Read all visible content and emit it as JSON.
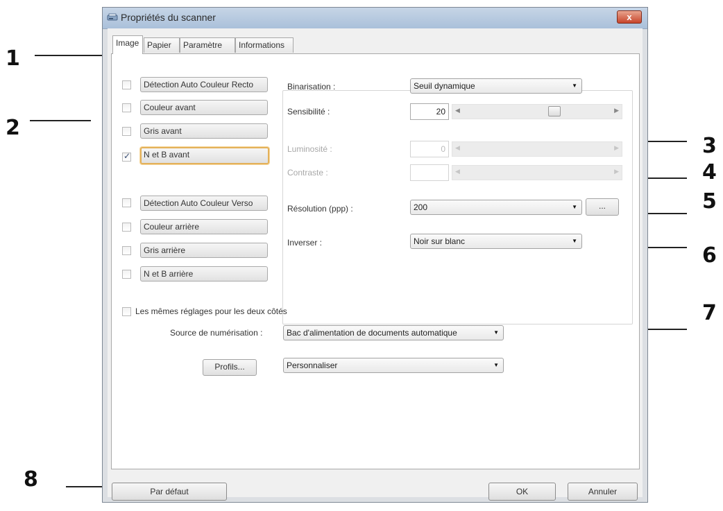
{
  "callouts": [
    "1",
    "2",
    "3",
    "4",
    "5",
    "6",
    "7",
    "8"
  ],
  "window": {
    "title": "Propriétés du scanner",
    "close_label": "x"
  },
  "tabs": [
    "Image",
    "Papier",
    "Paramètre",
    "Informations"
  ],
  "image_modes": [
    {
      "label": "Détection Auto Couleur Recto",
      "checked": false
    },
    {
      "label": "Couleur avant",
      "checked": false
    },
    {
      "label": "Gris avant",
      "checked": false
    },
    {
      "label": "N et B avant",
      "checked": true
    },
    {
      "label": "Détection Auto Couleur Verso",
      "checked": false
    },
    {
      "label": "Couleur arrière",
      "checked": false
    },
    {
      "label": "Gris arrière",
      "checked": false
    },
    {
      "label": "N et B arrière",
      "checked": false
    }
  ],
  "settings": {
    "binarisation_label": "Binarisation :",
    "binarisation_value": "Seuil dynamique",
    "sensibilite_label": "Sensibilité :",
    "sensibilite_value": "20",
    "luminosite_label": "Luminosité :",
    "luminosite_value": "0",
    "contraste_label": "Contraste :",
    "contraste_value": "",
    "resolution_label": "Résolution (ppp) :",
    "resolution_value": "200",
    "resolution_more": "...",
    "inverser_label": "Inverser :",
    "inverser_value": "Noir sur blanc"
  },
  "same_settings_label": "Les mêmes réglages pour les deux côtés",
  "source": {
    "label": "Source de numérisation :",
    "value": "Bac d'alimentation de documents automatique"
  },
  "profile": {
    "button_label": "Profils...",
    "value": "Personnaliser"
  },
  "footer": {
    "default_label": "Par défaut",
    "ok_label": "OK",
    "cancel_label": "Annuler"
  }
}
